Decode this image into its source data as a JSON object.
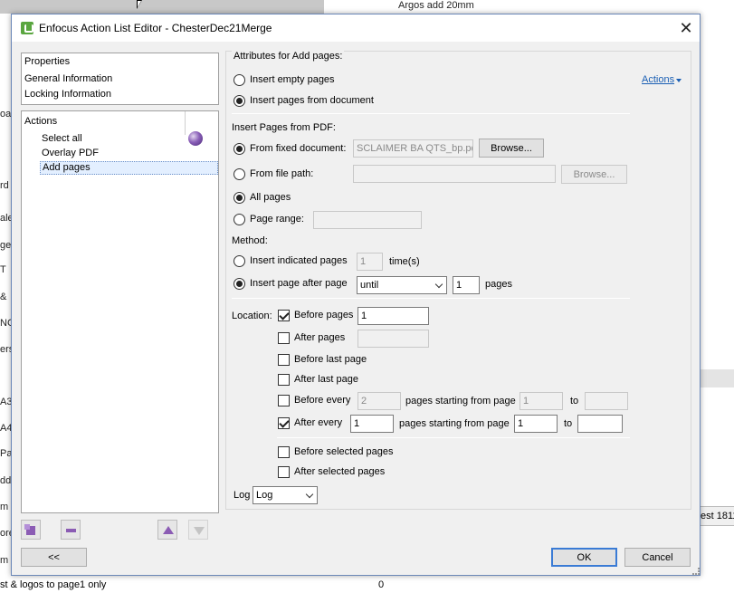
{
  "background": {
    "top_right_text": "Argos add 20mm",
    "left_fragments": [
      "oa",
      "rd",
      "ale",
      "ges",
      "T",
      "&",
      "NG",
      "ers",
      "A3",
      "A4",
      "Pa",
      "ddo",
      "m",
      "ore",
      "m"
    ],
    "right_cell_text": "est 1811",
    "bottom_text": "st & logos to page1 only",
    "bottom_number": "0"
  },
  "dialog": {
    "title": "Enfocus Action List Editor - ChesterDec21Merge",
    "close_glyph": "✕"
  },
  "properties": {
    "header": "Properties",
    "items": [
      "General Information",
      "Locking Information"
    ]
  },
  "actions_list": {
    "header": "Actions",
    "items": [
      "Select all",
      "Overlay PDF",
      "Add pages"
    ],
    "selected_index": 2
  },
  "footer": {
    "back_label": "<<",
    "ok_label": "OK",
    "cancel_label": "Cancel"
  },
  "attributes": {
    "group_title": "Attributes for Add pages:",
    "actions_link": "Actions",
    "insert_empty_label": "Insert empty pages",
    "insert_from_doc_label": "Insert pages from document",
    "insert_mode_selected": "Insert pages from document",
    "insert_from_pdf_label": "Insert Pages from PDF:",
    "fixed_document_label": "From fixed document:",
    "fixed_document_value": "SCLAIMER BA QTS_bp.pdf",
    "browse_label": "Browse...",
    "file_path_label": "From file path:",
    "file_path_value": "",
    "source_selected": "From fixed document:",
    "all_pages_label": "All pages",
    "page_range_label": "Page range:",
    "page_range_value": "",
    "range_selected": "All pages",
    "method_label": "Method:",
    "insert_indicated_label": "Insert indicated pages",
    "indicated_count": "1",
    "times_label": "time(s)",
    "insert_after_label": "Insert page after page",
    "after_mode_value": "until",
    "after_count": "1",
    "pages_unit": "pages",
    "method_selected": "Insert page after page",
    "location_label": "Location:",
    "before_pages_label": "Before pages",
    "before_pages_value": "1",
    "before_pages_checked": true,
    "after_pages_label": "After pages",
    "after_pages_value": "",
    "after_pages_checked": false,
    "before_last_label": "Before last page",
    "before_last_checked": false,
    "after_last_label": "After last page",
    "after_last_checked": false,
    "before_every_label": "Before every",
    "before_every_value": "2",
    "before_every_checked": false,
    "pages_starting_label": "pages starting from page",
    "before_every_start": "1",
    "to_label": "to",
    "before_every_to": "",
    "after_every_label": "After every",
    "after_every_value": "1",
    "after_every_checked": true,
    "after_every_start": "1",
    "after_every_to": "",
    "before_selected_label": "Before selected pages",
    "before_selected_checked": false,
    "after_selected_label": "After selected pages",
    "after_selected_checked": false
  },
  "log": {
    "label": "Log",
    "value": "Log"
  }
}
